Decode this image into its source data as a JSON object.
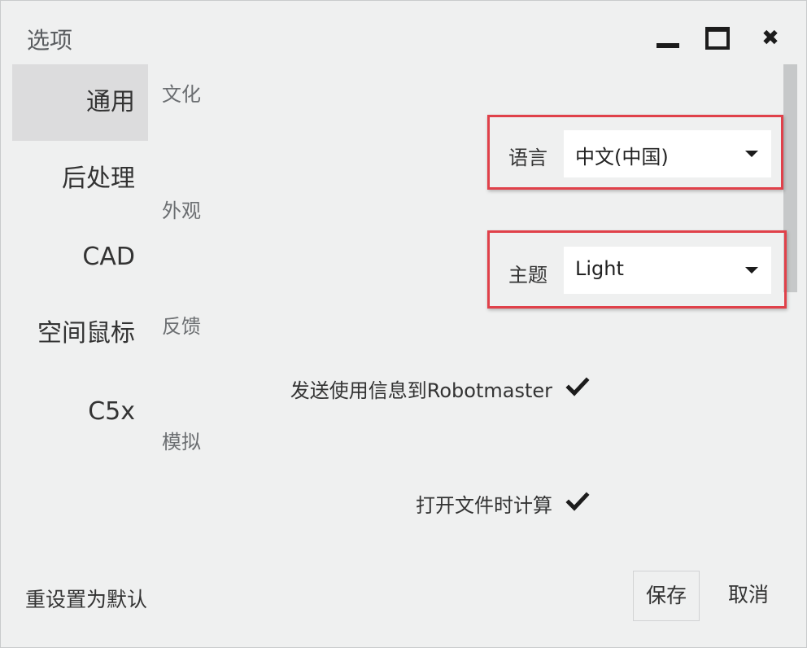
{
  "window": {
    "title": "选项"
  },
  "sidebar": {
    "items": [
      {
        "label": "通用",
        "active": true
      },
      {
        "label": "后处理",
        "active": false
      },
      {
        "label": "CAD",
        "active": false
      },
      {
        "label": "空间鼠标",
        "active": false
      },
      {
        "label": "C5x",
        "active": false
      }
    ]
  },
  "sections": {
    "culture": "文化",
    "appearance": "外观",
    "feedback": "反馈",
    "simulation": "模拟"
  },
  "settings": {
    "language": {
      "label": "语言",
      "value": "中文(中国)"
    },
    "theme": {
      "label": "主题",
      "value": "Light"
    },
    "send_usage": {
      "label": "发送使用信息到Robotmaster",
      "checked": true
    },
    "compute_on_open": {
      "label": "打开文件时计算",
      "checked": true
    }
  },
  "footer": {
    "reset_label": "重设置为默认",
    "save_label": "保存",
    "cancel_label": "取消"
  },
  "colors": {
    "background": "#eff0f0",
    "highlight_border": "#e0414a",
    "active_nav": "#dcdcdd"
  },
  "icons": {
    "minimize": "minimize-icon",
    "maximize": "maximize-icon",
    "close": "close-icon",
    "dropdown": "chevron-down-icon",
    "check": "checkmark-icon"
  }
}
